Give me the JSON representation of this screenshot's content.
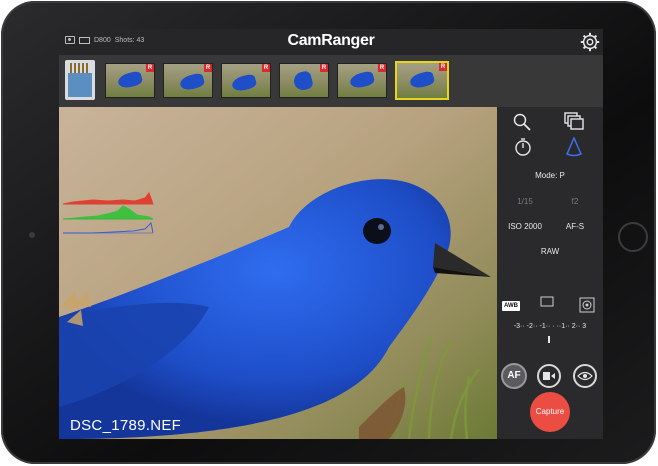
{
  "app": {
    "title": "CamRanger"
  },
  "status_bar": {
    "camera_model": "D800",
    "shots_label": "Shots: 43"
  },
  "thumbnails": [
    {
      "badge": "R",
      "selected": false
    },
    {
      "badge": "R",
      "selected": false
    },
    {
      "badge": "R",
      "selected": false
    },
    {
      "badge": "R",
      "selected": false
    },
    {
      "badge": "R",
      "selected": false
    },
    {
      "badge": "R",
      "selected": true
    }
  ],
  "photo": {
    "filename": "DSC_1789.NEF"
  },
  "settings": {
    "mode": "Mode: P",
    "shutter": "1/15",
    "aperture": "f2",
    "iso": "ISO 2000",
    "focus": "AF-S",
    "format": "RAW",
    "wb": "AWB",
    "exposure_scale": "-3·· -2·· -1·· · ··1·· 2·· 3"
  },
  "buttons": {
    "af": "AF",
    "capture": "Capture"
  },
  "colors": {
    "accent": "#ec4d43",
    "selection": "#e5d51f",
    "bird": "#1e4ec8"
  }
}
